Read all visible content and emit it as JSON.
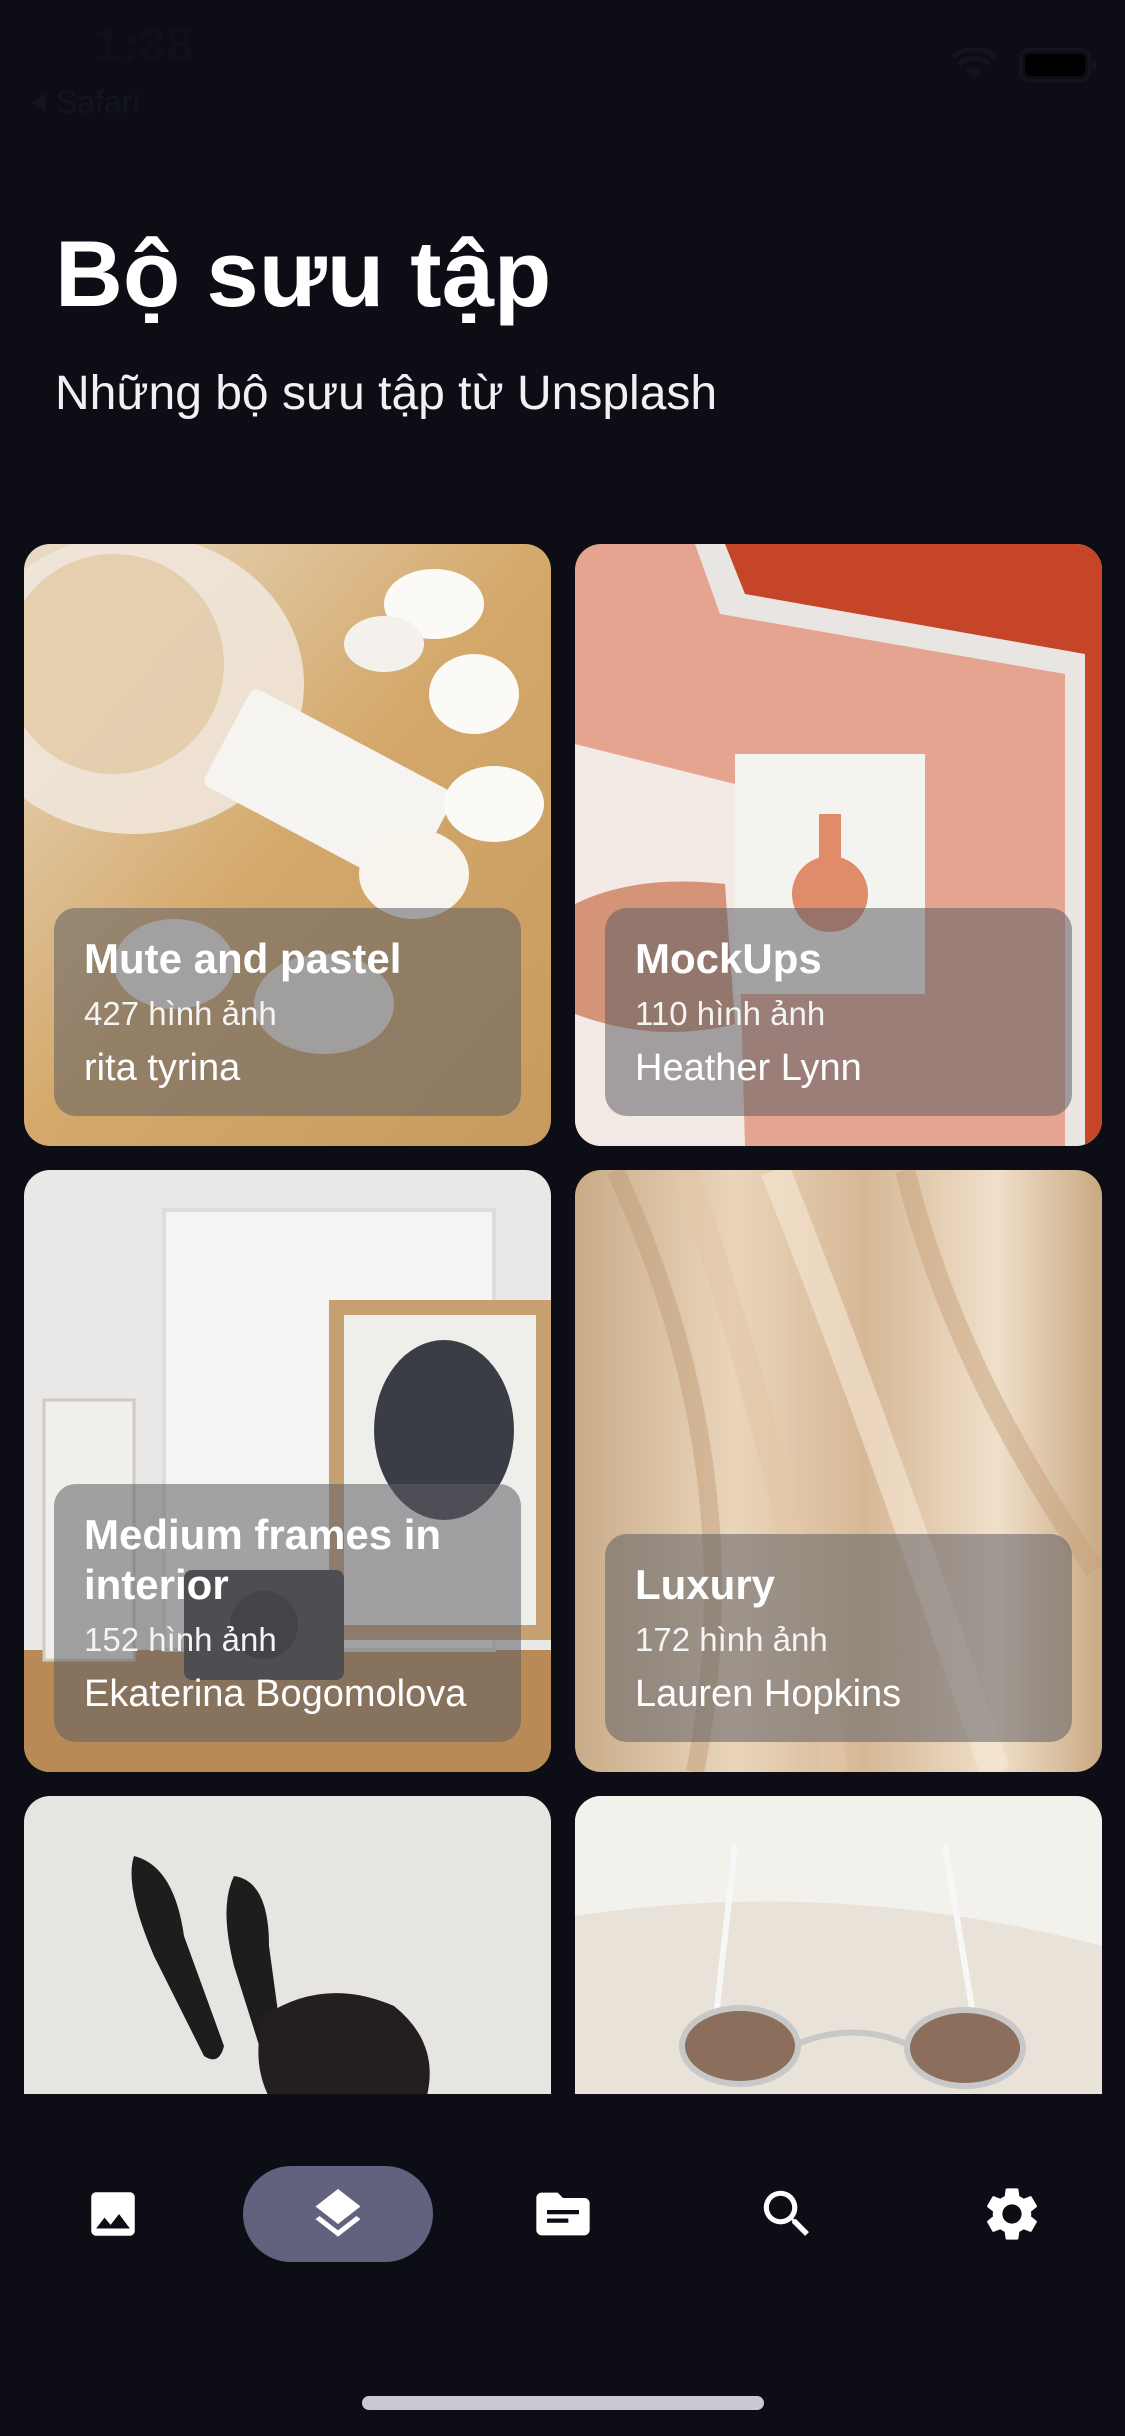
{
  "status_bar": {
    "time": "1:38",
    "back_app": "Safari"
  },
  "header": {
    "title": "Bộ sưu tập",
    "subtitle": "Những bộ sưu tập từ Unsplash"
  },
  "collections": [
    {
      "title": "Mute and pastel",
      "count": "427 hình ảnh",
      "author": "rita tyrina"
    },
    {
      "title": "MockUps",
      "count": "110 hình ảnh",
      "author": "Heather Lynn"
    },
    {
      "title": "Medium frames in interior",
      "count": "152 hình ảnh",
      "author": "Ekaterina Bogomolova"
    },
    {
      "title": "Luxury",
      "count": "172 hình ảnh",
      "author": "Lauren Hopkins"
    }
  ],
  "bottom_nav": {
    "items": [
      {
        "icon": "image-icon",
        "active": false
      },
      {
        "icon": "layers-icon",
        "active": true
      },
      {
        "icon": "article-icon",
        "active": false
      },
      {
        "icon": "search-icon",
        "active": false
      },
      {
        "icon": "gear-icon",
        "active": false
      }
    ],
    "active_color": "#60627e"
  }
}
